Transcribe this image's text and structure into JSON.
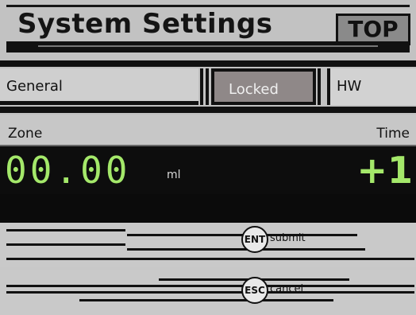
{
  "header": {
    "title": "System Settings",
    "top_button": "TOP"
  },
  "tabs": [
    {
      "label": "General"
    },
    {
      "label": "Locked",
      "active": true
    },
    {
      "label": "HW"
    }
  ],
  "section": {
    "left_label": "Zone",
    "right_label": "Time",
    "value": "00.00",
    "unit": "ml",
    "delta": "+1"
  },
  "actions": [
    {
      "key": "ENT",
      "label": "submit"
    },
    {
      "key": "ESC",
      "label": "cancel"
    }
  ],
  "colors": {
    "value_green": "#a4e86a",
    "panel_gray": "#c8c8c8",
    "bar_black": "#0d0d0d"
  }
}
